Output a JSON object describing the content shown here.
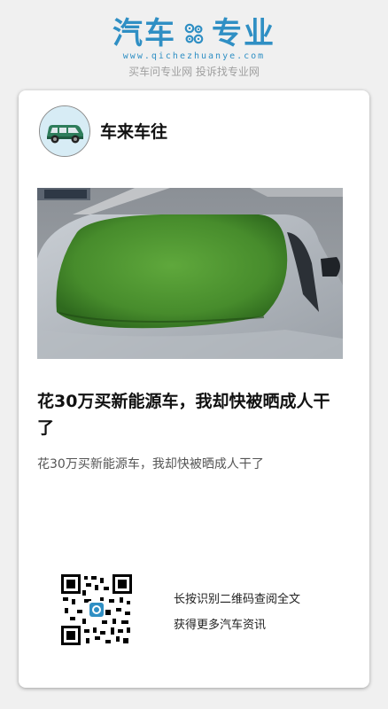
{
  "header": {
    "logo_left": "汽车",
    "logo_right": "专业",
    "logo_url": "www.qichezhuanye.com",
    "tagline": "买车问专业网 投诉找专业网",
    "gear_icon": "gear-icon"
  },
  "article": {
    "author": "车来车往",
    "title": "花30万买新能源车，我却快被晒成人干了",
    "summary": "花30万买新能源车，我却快被晒成人干了"
  },
  "qr": {
    "line1": "长按识别二维码查阅全文",
    "line2": "获得更多汽车资讯"
  },
  "colors": {
    "brand": "#2f8fc4",
    "background": "#f0f0f0",
    "card": "#ffffff"
  }
}
